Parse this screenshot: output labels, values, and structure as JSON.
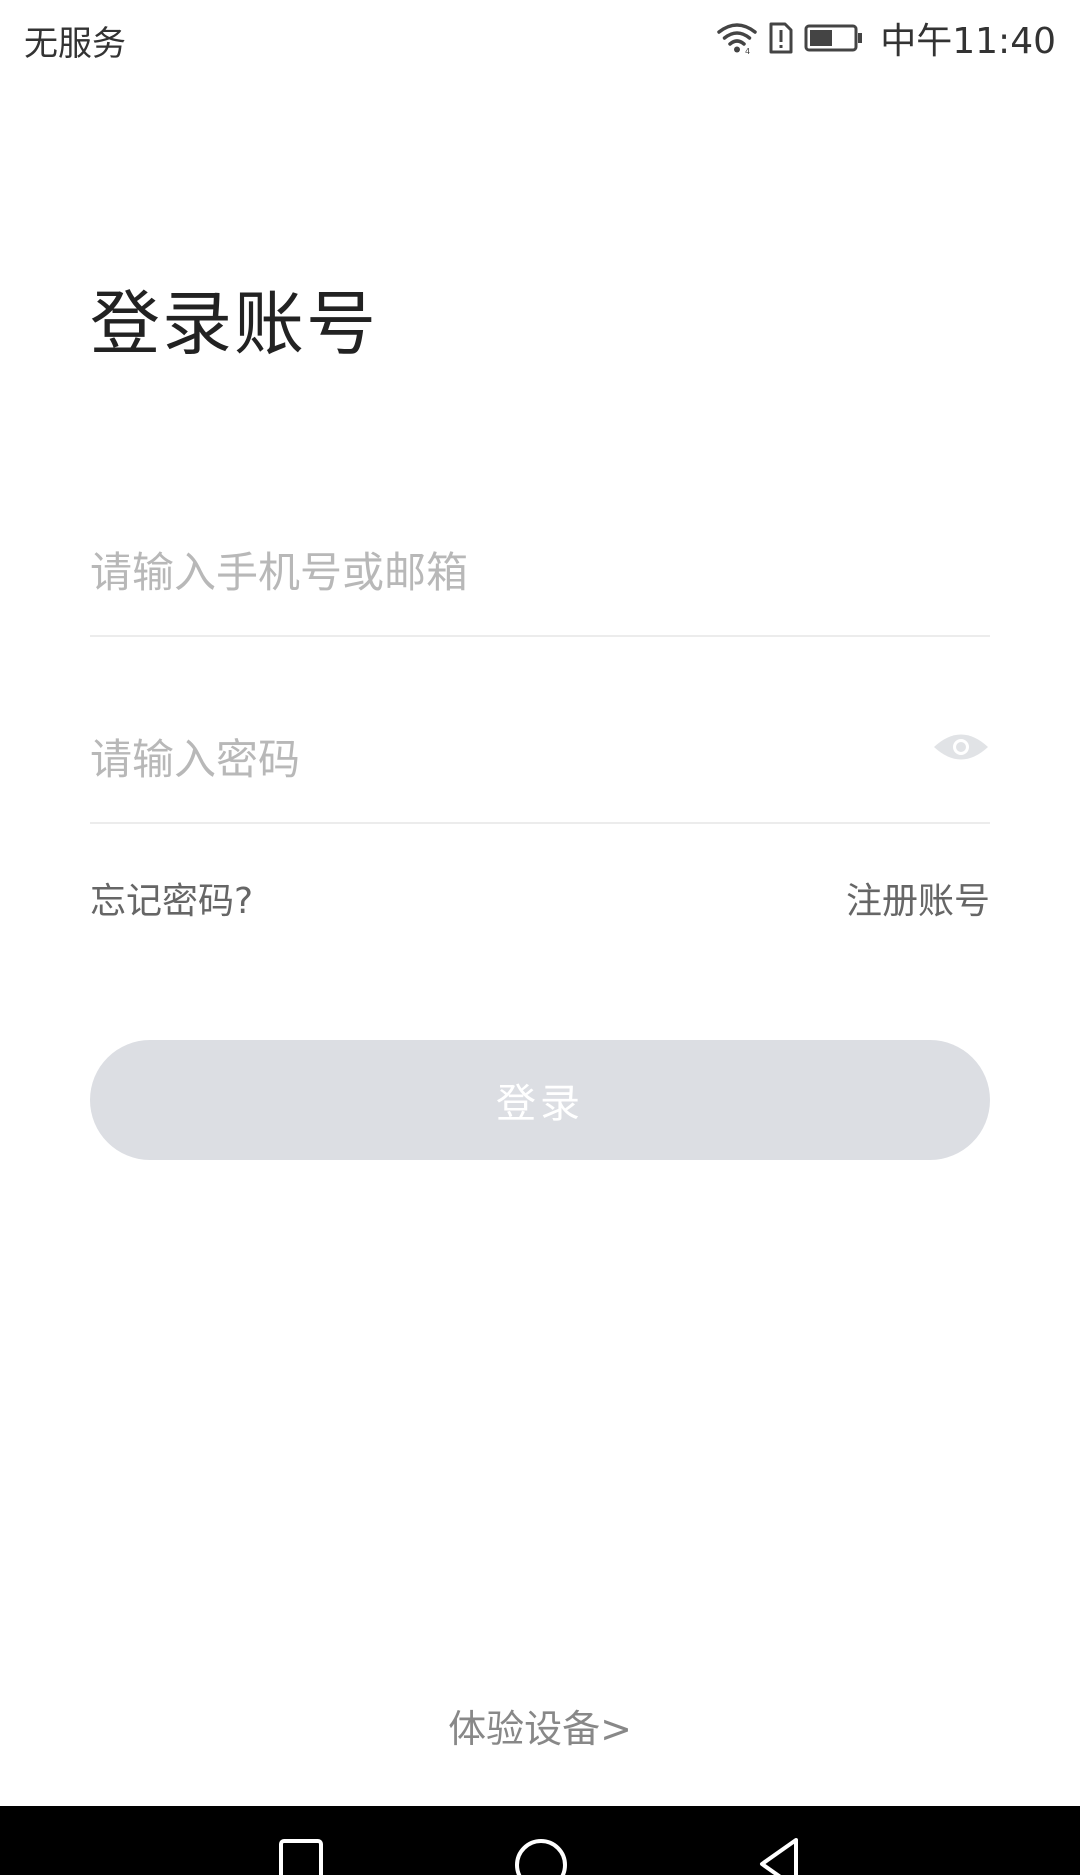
{
  "status_bar": {
    "carrier": "无服务",
    "time": "中午11:40",
    "icons": [
      "wifi-icon",
      "sim-alert-icon",
      "battery-icon"
    ]
  },
  "login": {
    "title": "登录账号",
    "account_placeholder": "请输入手机号或邮箱",
    "password_placeholder": "请输入密码",
    "forgot_password": "忘记密码?",
    "register": "注册账号",
    "login_button": "登录",
    "demo_device": "体验设备>"
  },
  "nav_bar": {
    "buttons": [
      "recent-apps-icon",
      "home-icon",
      "back-icon"
    ]
  },
  "colors": {
    "button_disabled_bg": "#dcdee3",
    "placeholder": "#b8b8b8",
    "divider": "#ececec",
    "nav_bar": "#000000"
  }
}
